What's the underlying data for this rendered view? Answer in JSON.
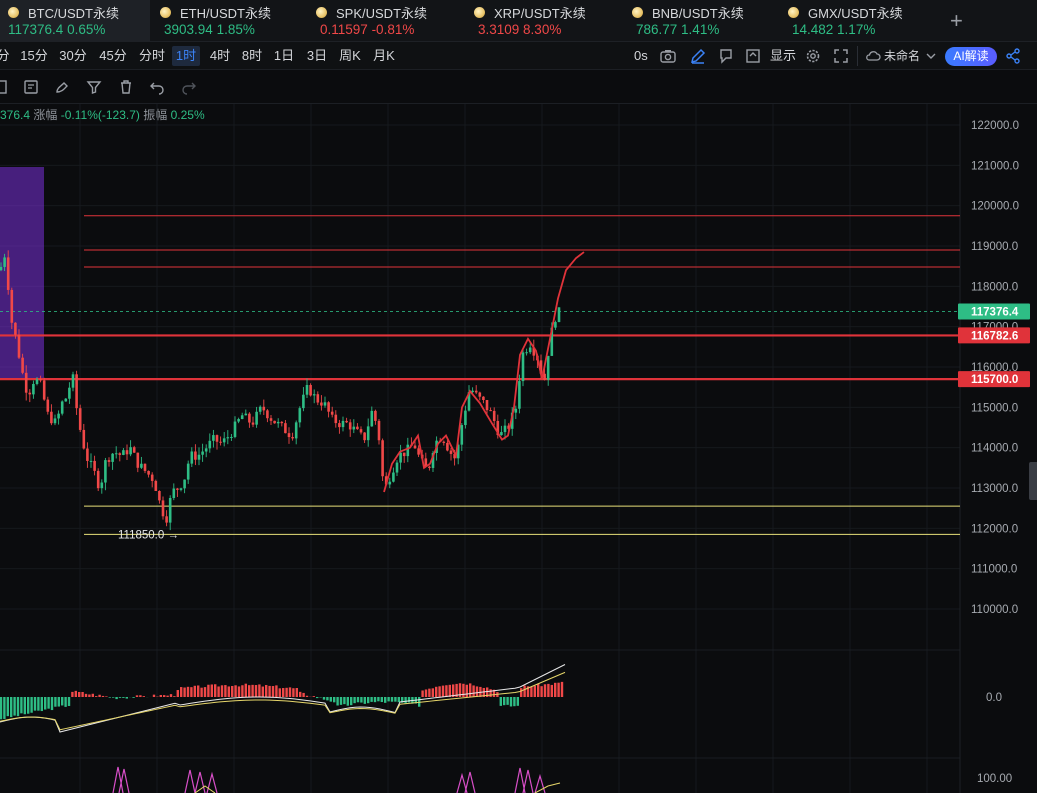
{
  "tabs": [
    {
      "name": "BTC/USDT永续",
      "price": "117376.4",
      "change": "0.65%",
      "dir": "pos",
      "active": true
    },
    {
      "name": "ETH/USDT永续",
      "price": "3903.94",
      "change": "1.85%",
      "dir": "pos",
      "active": false
    },
    {
      "name": "SPK/USDT永续",
      "price": "0.11597",
      "change": "-0.81%",
      "dir": "neg",
      "active": false
    },
    {
      "name": "XRP/USDT永续",
      "price": "3.3109",
      "change": "8.30%",
      "dir": "neg",
      "active": false
    },
    {
      "name": "BNB/USDT永续",
      "price": "786.77",
      "change": "1.41%",
      "dir": "pos",
      "active": false
    },
    {
      "name": "GMX/USDT永续",
      "price": "14.482",
      "change": "1.17%",
      "dir": "pos",
      "active": false
    }
  ],
  "intervals": [
    "分",
    "15分",
    "30分",
    "45分",
    "分时",
    "1时",
    "4时",
    "8时",
    "1日",
    "3日",
    "周K",
    "月K"
  ],
  "active_interval": "1时",
  "toolbar": {
    "countdown": "0s",
    "display_label": "显示",
    "layout_name": "未命名",
    "ai_label": "AI解读"
  },
  "info_line": {
    "last_fragment": "376.4",
    "amplitude_label": "涨幅",
    "amplitude_value": "-0.11%(-123.7)",
    "swing_label": "振幅",
    "swing_value": "0.25%"
  },
  "colors": {
    "up": "#2ebd85",
    "down": "#f04848",
    "level_line": "#e0333a",
    "support_line": "#e8e07a",
    "drawn_path": "#e0333a",
    "zone_fill": "#7a2fd8"
  },
  "chart_data": {
    "type": "candlestick",
    "y_axis_ticks": [
      "122000.0",
      "121000.0",
      "120000.0",
      "119000.0",
      "118000.0",
      "117000.0",
      "116000.0",
      "115000.0",
      "114000.0",
      "113000.0",
      "112000.0",
      "111000.0",
      "110000.0"
    ],
    "ylim": [
      109500,
      122500
    ],
    "price_badges": [
      {
        "label": "117376.4",
        "value": 117376.4,
        "color": "#2ebd85"
      },
      {
        "label": "116782.6",
        "value": 116782.6,
        "color": "#e0333a"
      },
      {
        "label": "115700.0",
        "value": 115700.0,
        "color": "#e0333a"
      }
    ],
    "horizontal_lines": [
      {
        "value": 119750,
        "style": "thin-red"
      },
      {
        "value": 118900,
        "style": "thin-red"
      },
      {
        "value": 118480,
        "style": "thin-red"
      },
      {
        "value": 116782.6,
        "style": "thick-red"
      },
      {
        "value": 115700,
        "style": "thick-red"
      },
      {
        "value": 112550,
        "style": "yellow"
      },
      {
        "value": 111850,
        "style": "yellow"
      }
    ],
    "low_marker": {
      "label": "111850.0 →",
      "value": 111850.0
    },
    "macd": {
      "zero_label": "0.0"
    },
    "rsi": {
      "top_label": "100.00"
    }
  }
}
